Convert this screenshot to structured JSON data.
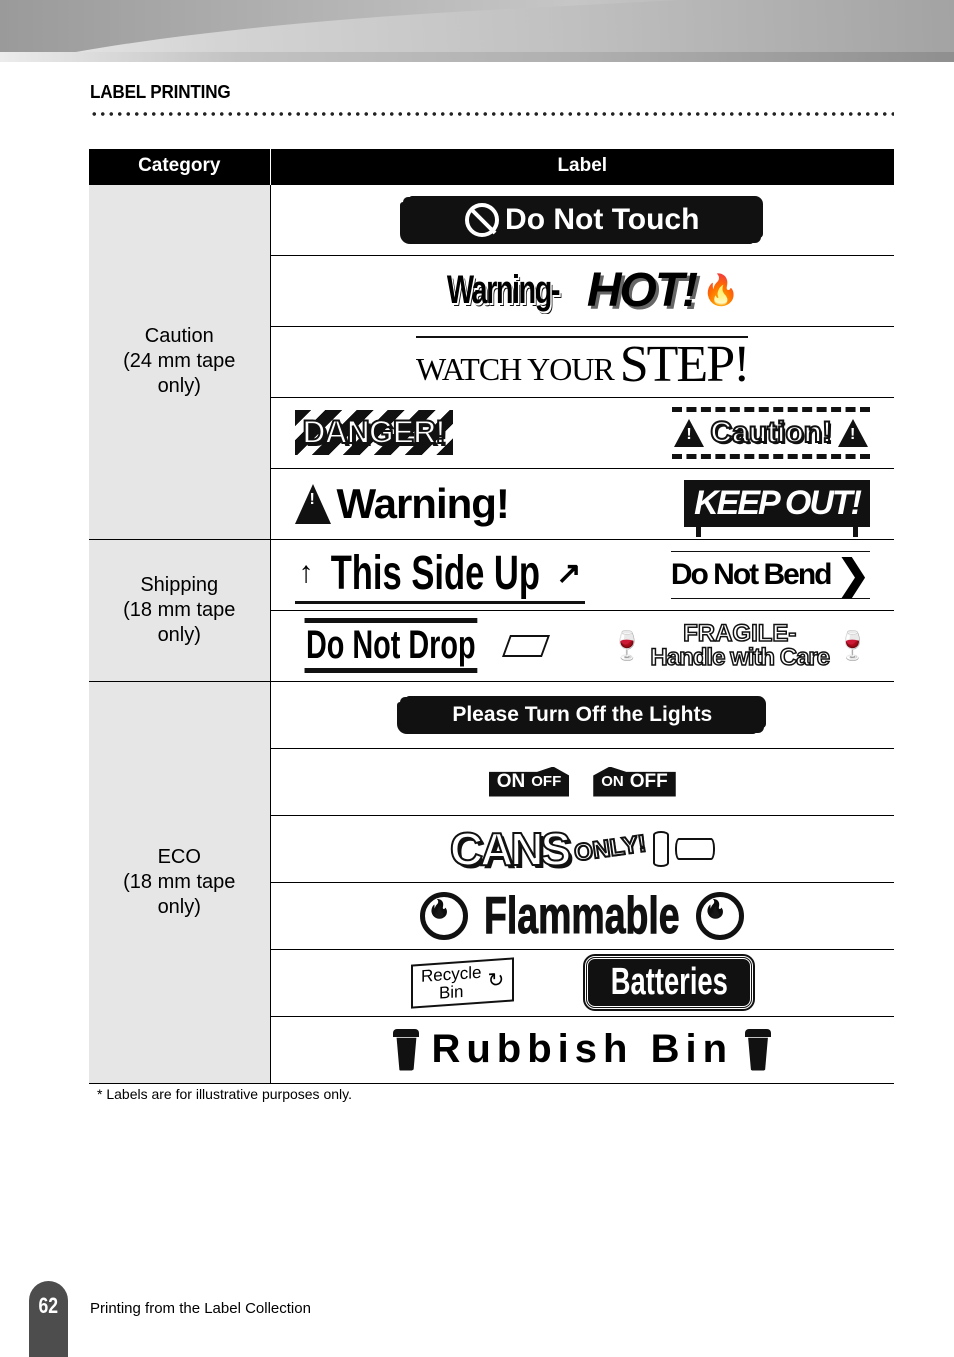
{
  "header": {
    "section_title": "LABEL PRINTING"
  },
  "table": {
    "columns": [
      "Category",
      "Label"
    ],
    "groups": [
      {
        "category": [
          "Caution",
          "(24 mm tape",
          "only)"
        ],
        "rows": [
          [
            "Do Not Touch"
          ],
          [
            "Warning-HOT!"
          ],
          [
            "WATCH YOUR STEP!"
          ],
          [
            "DANGER!",
            "Caution!"
          ],
          [
            "Warning!",
            "KEEP OUT!"
          ]
        ]
      },
      {
        "category": [
          "Shipping",
          "(18 mm tape",
          "only)"
        ],
        "rows": [
          [
            "This Side Up",
            "Do Not Bend"
          ],
          [
            "Do Not Drop",
            "FRAGILE-Handle with Care"
          ]
        ]
      },
      {
        "category": [
          "ECO",
          "(18 mm tape",
          "only)"
        ],
        "rows": [
          [
            "Please Turn Off the Lights"
          ],
          [
            "ON OFF",
            "ON OFF"
          ],
          [
            "CANS ONLY!"
          ],
          [
            "Flammable"
          ],
          [
            "Recycle Bin",
            "Batteries"
          ],
          [
            "Rubbish Bin"
          ]
        ]
      }
    ],
    "label_parts": {
      "warning_hot": [
        "Warning-",
        "HOT!"
      ],
      "watch_step": [
        "WATCH YOUR",
        "STEP!"
      ],
      "fragile": [
        "FRAGILE-",
        "Handle with Care"
      ],
      "cans_only": [
        "CANS",
        "ONLY!"
      ],
      "switch_left": [
        "ON",
        "OFF"
      ],
      "switch_right": [
        "ON",
        "OFF"
      ],
      "recycle": [
        "Recycle",
        "Bin"
      ]
    }
  },
  "footnote": "* Labels are for illustrative purposes only.",
  "footer": {
    "page_number": "62",
    "text": "Printing from the Label Collection"
  }
}
